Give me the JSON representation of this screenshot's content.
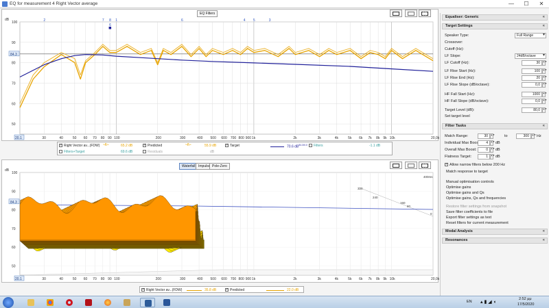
{
  "window": {
    "title": "EQ for measurement 4 Right Vector average",
    "minimize": "—",
    "maximize": "☐",
    "close": "✕"
  },
  "top_graph": {
    "eq_filters_button": "EQ Filters",
    "y_unit": "dB",
    "y_ticks": [
      "100",
      "90",
      "84.3",
      "80",
      "70",
      "60",
      "50"
    ],
    "x_ticks": [
      "20.1",
      "30",
      "40",
      "50",
      "60",
      "70",
      "80",
      "90",
      "100",
      "200",
      "300",
      "400",
      "500",
      "600",
      "700",
      "800",
      "900",
      "1k",
      "2k",
      "3k",
      "4k",
      "5k",
      "6k",
      "7k",
      "8k",
      "9k",
      "10k",
      "20,0kHz"
    ],
    "filter_markers": [
      "2",
      "7",
      "8",
      "1",
      "6",
      "4",
      "5",
      "3"
    ],
    "filter_marker_detail": "6",
    "target_level_readout": "84.3",
    "x_start_readout": "20.1",
    "colors": {
      "measurement": "#e8a400",
      "target": "#1f1f99"
    },
    "chart_data": {
      "type": "line",
      "xscale": "log",
      "xlim": [
        20,
        20000
      ],
      "ylim": [
        45,
        100
      ],
      "series": [
        {
          "name": "Right Vector av...(FDW)",
          "x": [
            20,
            25,
            30,
            40,
            50,
            55,
            60,
            70,
            80,
            90,
            100,
            120,
            150,
            180,
            200,
            220,
            250,
            300,
            350,
            400,
            450,
            500,
            600,
            700,
            800,
            900,
            1000,
            1200,
            1500,
            1800,
            2000,
            2500,
            3000,
            3500,
            4000,
            5000,
            6000,
            7000,
            8000,
            9000,
            10000,
            12000,
            15000,
            20000
          ],
          "y": [
            58,
            72,
            78,
            84,
            80,
            72,
            80,
            84,
            88,
            85,
            85,
            88,
            84,
            86,
            79,
            86,
            84,
            88,
            83,
            87,
            83,
            86,
            84,
            86,
            84,
            87,
            85,
            86,
            83,
            87,
            84,
            86,
            83,
            86,
            84,
            86,
            82,
            85,
            84,
            82,
            86,
            82,
            86,
            81
          ]
        },
        {
          "name": "Predicted",
          "x": [
            20,
            25,
            30,
            40,
            50,
            55,
            60,
            70,
            80,
            90,
            100,
            120,
            150,
            180,
            200,
            220,
            250,
            300,
            350,
            400,
            450,
            500,
            600,
            700,
            800,
            900,
            1000,
            1200,
            1500,
            1800,
            2000,
            2500,
            3000,
            3500,
            4000,
            5000,
            6000,
            7000,
            8000,
            9000,
            10000,
            12000,
            15000,
            20000
          ],
          "y": [
            60,
            74,
            80,
            85,
            82,
            74,
            81,
            85,
            89,
            86,
            86,
            89,
            85,
            87,
            80,
            87,
            85,
            89,
            84,
            88,
            84,
            87,
            85,
            87,
            85,
            88,
            86,
            87,
            84,
            88,
            85,
            87,
            84,
            87,
            85,
            87,
            83,
            86,
            85,
            83,
            87,
            83,
            87,
            82
          ]
        },
        {
          "name": "Target",
          "x": [
            20,
            30,
            40,
            50,
            60,
            80,
            100,
            150,
            200,
            300,
            500,
            1000,
            2000,
            5000,
            10000,
            20000
          ],
          "y": [
            73,
            79,
            82,
            83.5,
            84,
            83.8,
            83.2,
            82.5,
            82,
            81.3,
            80.6,
            79.9,
            79.2,
            78.2,
            77,
            75.8
          ]
        }
      ]
    }
  },
  "top_legend": {
    "items": [
      {
        "label": "Right Vector av...(FDW)",
        "value": "65.2 dB",
        "checked": true
      },
      {
        "label": "Predicted",
        "value": "55.9 dB",
        "checked": true
      },
      {
        "label": "Target",
        "value": "70.6 dB",
        "checked": true
      },
      {
        "label": "Filters",
        "value": "-1.1 dB",
        "checked": false
      },
      {
        "label": "Filters+Target",
        "value": "69.6 dB",
        "checked": false
      },
      {
        "label": "Residuals",
        "value": "dB",
        "checked": false
      }
    ],
    "target_suffix": "84.3/0.0"
  },
  "bottom_graph": {
    "tabs": [
      "Waterfall",
      "Impulse",
      "Pole-Zero"
    ],
    "active_tab": "Waterfall",
    "y_unit": "dB",
    "y_ticks": [
      "100",
      "90",
      "84.3",
      "80",
      "70",
      "60",
      "50"
    ],
    "x_ticks": [
      "20.1",
      "30",
      "40",
      "50",
      "60",
      "70",
      "80",
      "90",
      "100",
      "200",
      "300",
      "400",
      "500",
      "600",
      "700",
      "800",
      "900",
      "1k",
      "2k",
      "3k",
      "4k",
      "5k",
      "6k",
      "7k",
      "8k",
      "9k",
      "10k",
      "20,0kHz"
    ],
    "time_labels": [
      "400ms",
      "320",
      "240",
      "160",
      "80",
      "0"
    ],
    "x_start_readout": "20.1"
  },
  "bottom_legend": {
    "items": [
      {
        "label": "Right Vector av...(FDW)",
        "value": "35.8 dB",
        "checked": true
      },
      {
        "label": "Predicted",
        "value": "22.0 dB",
        "checked": true
      }
    ]
  },
  "right_panel": {
    "equaliser": {
      "title": "Equaliser: Generic"
    },
    "target_settings": {
      "title": "Target Settings",
      "speaker_type_label": "Speaker Type:",
      "speaker_type_value": "Full Range",
      "crossover_label": "Crossover:",
      "cutoff_label": "Cutoff (Hz):",
      "lf_slope_label": "LF Slope:",
      "lf_slope_value": "24dB/octave",
      "lf_cutoff_label": "LF Cutoff (Hz):",
      "lf_cutoff_value": "30",
      "lf_rise_start_label": "LF Rise Start (Hz):",
      "lf_rise_start_value": "100",
      "lf_rise_end_label": "LF Rise End (Hz):",
      "lf_rise_end_value": "20",
      "lf_rise_slope_label": "LF Rise Slope (dB/octave):",
      "lf_rise_slope_value": "0,0",
      "hf_fall_start_label": "HF Fall Start (Hz):",
      "hf_fall_start_value": "1000",
      "hf_fall_slope_label": "HF Fall Slope (dB/octave):",
      "hf_fall_slope_value": "0,0",
      "target_level_label": "Target Level (dB):",
      "target_level_value": "80,0",
      "set_target_level": "Set target level"
    },
    "filter_tasks": {
      "title": "Filter Tasks",
      "match_range_label": "Match Range:",
      "match_range_from": "30",
      "match_range_to_label": "to",
      "match_range_to": "300",
      "hz_unit": "Hz",
      "indiv_max_boost_label": "Individual Max Boost:",
      "indiv_max_boost_value": "4",
      "overall_max_boost_label": "Overall Max Boost:",
      "overall_max_boost_value": "0",
      "flatness_target_label": "Flatness Target:",
      "flatness_target_value": "1",
      "db_unit": "dB",
      "allow_narrow_label": "Allow narrow filters below 200 Hz",
      "match_response": "Match response to target",
      "manual_controls": "Manual optimisation controls",
      "optimise_gains": "Optimise gains",
      "optimise_gains_q": "Optimise gains and Qs",
      "optimise_gains_q_freq": "Optimise gains, Qs and frequencies",
      "restore_settings": "Restore filter settings from snapshot",
      "save_coeffs": "Save filter coefficients to file",
      "export_settings": "Export filter settings as text",
      "reset_filters": "Reset filters for current measurement"
    },
    "modal_analysis": {
      "title": "Modal Analysis"
    },
    "resonances": {
      "title": "Resonances"
    }
  },
  "taskbar": {
    "apps": [
      "start",
      "explorer",
      "chrome",
      "opera",
      "app-red",
      "firefox-like",
      "folder",
      "rew",
      "word"
    ],
    "lang": "EN",
    "time": "2:52 μμ",
    "date": "17/5/2020"
  }
}
